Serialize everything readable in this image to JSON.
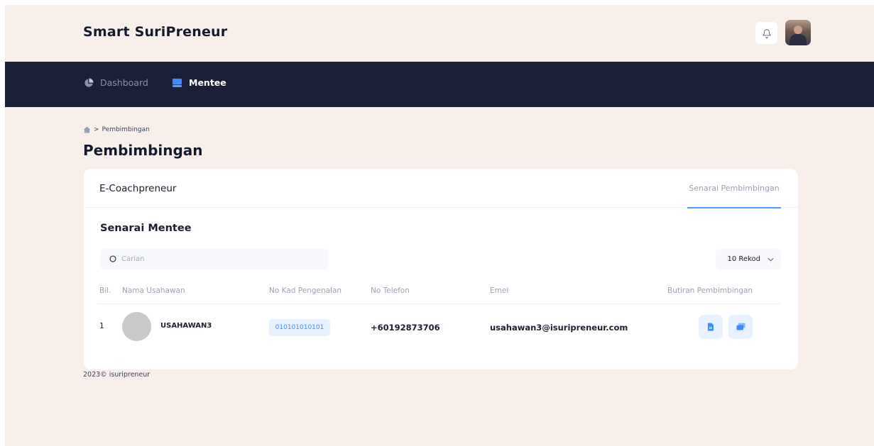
{
  "header": {
    "brand": "Smart SuriPreneur",
    "bell_icon": "bell-icon",
    "avatar_icon": "user-avatar"
  },
  "nav": {
    "items": [
      {
        "label": "Dashboard",
        "icon": "pie-chart-icon",
        "active": false
      },
      {
        "label": "Mentee",
        "icon": "monitor-icon",
        "active": true
      }
    ]
  },
  "breadcrumb": {
    "home_icon": "home-icon",
    "separator": ">",
    "current": "Pembimbingan"
  },
  "page": {
    "title": "Pembimbingan"
  },
  "card": {
    "title": "E-Coachpreneur",
    "tab_label": "Senarai Pembimbingan",
    "section_title": "Senarai Mentee",
    "search": {
      "placeholder": "Carian",
      "value": ""
    },
    "per_page": {
      "selected": "10 Rekod"
    }
  },
  "table": {
    "headers": [
      "Bil.",
      "Nama Usahawan",
      "No Kad Pengenalan",
      "No Telefon",
      "Emel",
      "Butiran Pembimbingan"
    ],
    "rows": [
      {
        "bil": "1",
        "nama": "USAHAWAN3",
        "ic": "010101010101",
        "phone": "+60192873706",
        "email": "usahawan3@isuripreneur.com"
      }
    ]
  },
  "footer": {
    "text": "2023© isuripreneur"
  },
  "colors": {
    "navbar": "#1b1f37",
    "background": "#f8efeb",
    "accent": "#3d8bff",
    "accent_light": "#e8f1ff"
  }
}
